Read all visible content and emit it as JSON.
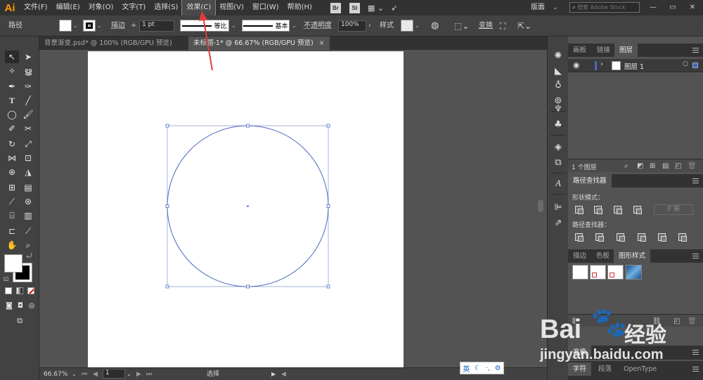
{
  "app": {
    "logo": "Ai"
  },
  "menu": {
    "items": [
      "文件(F)",
      "编辑(E)",
      "对象(O)",
      "文字(T)",
      "选择(S)",
      "效果(C)",
      "视图(V)",
      "窗口(W)",
      "帮助(H)"
    ],
    "active_index": 5,
    "bridge": "Br",
    "stock": "St",
    "workspace": "版面",
    "search_placeholder": "搜索 Adobe Stock"
  },
  "control": {
    "object_type": "路径",
    "stroke_label": "描边",
    "stroke_weight": "1 pt",
    "profile": "等比",
    "brush": "基本",
    "opacity_label": "不透明度",
    "opacity": "100%",
    "style_label": "样式",
    "transform": "变换"
  },
  "tabs": [
    {
      "label": "背景渐变.psd* @ 100% (RGB/GPU 预览)"
    },
    {
      "label": "未标题-1* @ 66.67% (RGB/GPU 预览)",
      "close": "×"
    }
  ],
  "status": {
    "zoom": "66.67%",
    "artboard": "1",
    "tool": "选择"
  },
  "layers_panel": {
    "tabs": [
      "画板",
      "链接",
      "图层"
    ],
    "layer_name": "图层 1",
    "count": "1 个图层"
  },
  "pathfinder_panel": {
    "title": "路径查找器",
    "shape_modes": "形状模式：",
    "pathfinders": "路径查找器：",
    "expand": "扩展"
  },
  "styles_panel": {
    "tabs": [
      "描边",
      "色板",
      "图形样式"
    ]
  },
  "bottom_panels": {
    "transform": "变换",
    "tabs": [
      "字符",
      "段落",
      "OpenType"
    ]
  },
  "ime": {
    "lang": "英"
  },
  "watermark": {
    "brand": "Bai",
    "brand2": "经验",
    "url": "jingyan.baidu.com"
  },
  "colors": {
    "accent": "#ff9a00",
    "selection": "#4a68c0",
    "panel_dark": "#323232"
  }
}
